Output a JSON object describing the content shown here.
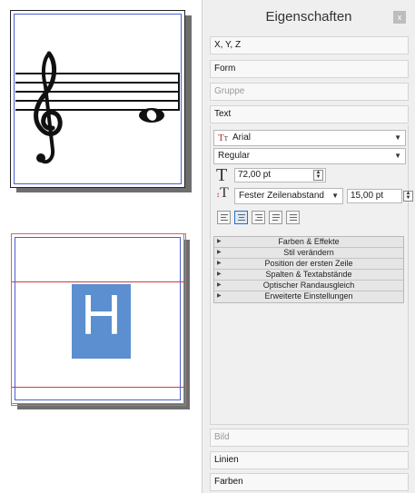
{
  "panel": {
    "title": "Eigenschaften",
    "close_label": "x",
    "sections_top": [
      {
        "label": "X, Y, Z",
        "enabled": true
      },
      {
        "label": "Form",
        "enabled": true
      },
      {
        "label": "Gruppe",
        "enabled": false
      },
      {
        "label": "Text",
        "enabled": true
      }
    ],
    "text": {
      "font_family": "Arial",
      "font_style": "Regular",
      "font_size": "72,00 pt",
      "line_spacing_mode": "Fester Zeilenabstand",
      "line_spacing_value": "15,00 pt",
      "alignment_options": [
        "left",
        "center",
        "right",
        "justify",
        "justify-all"
      ],
      "alignment_selected": "center",
      "accordion": [
        "Farben & Effekte",
        "Stil verändern",
        "Position der ersten Zeile",
        "Spalten & Textabstände",
        "Optischer Randausgleich",
        "Erweiterte Einstellungen"
      ]
    },
    "sections_bottom": [
      {
        "label": "Bild",
        "enabled": false
      },
      {
        "label": "Linien",
        "enabled": true
      },
      {
        "label": "Farben",
        "enabled": true
      }
    ]
  },
  "canvas": {
    "page1_content": "music staff with treble clef and whole note",
    "page2_letter": "H",
    "letter_color": "#5b8fcf",
    "frame_color": "#d23a3a",
    "margin_color": "#4a5fd0"
  }
}
